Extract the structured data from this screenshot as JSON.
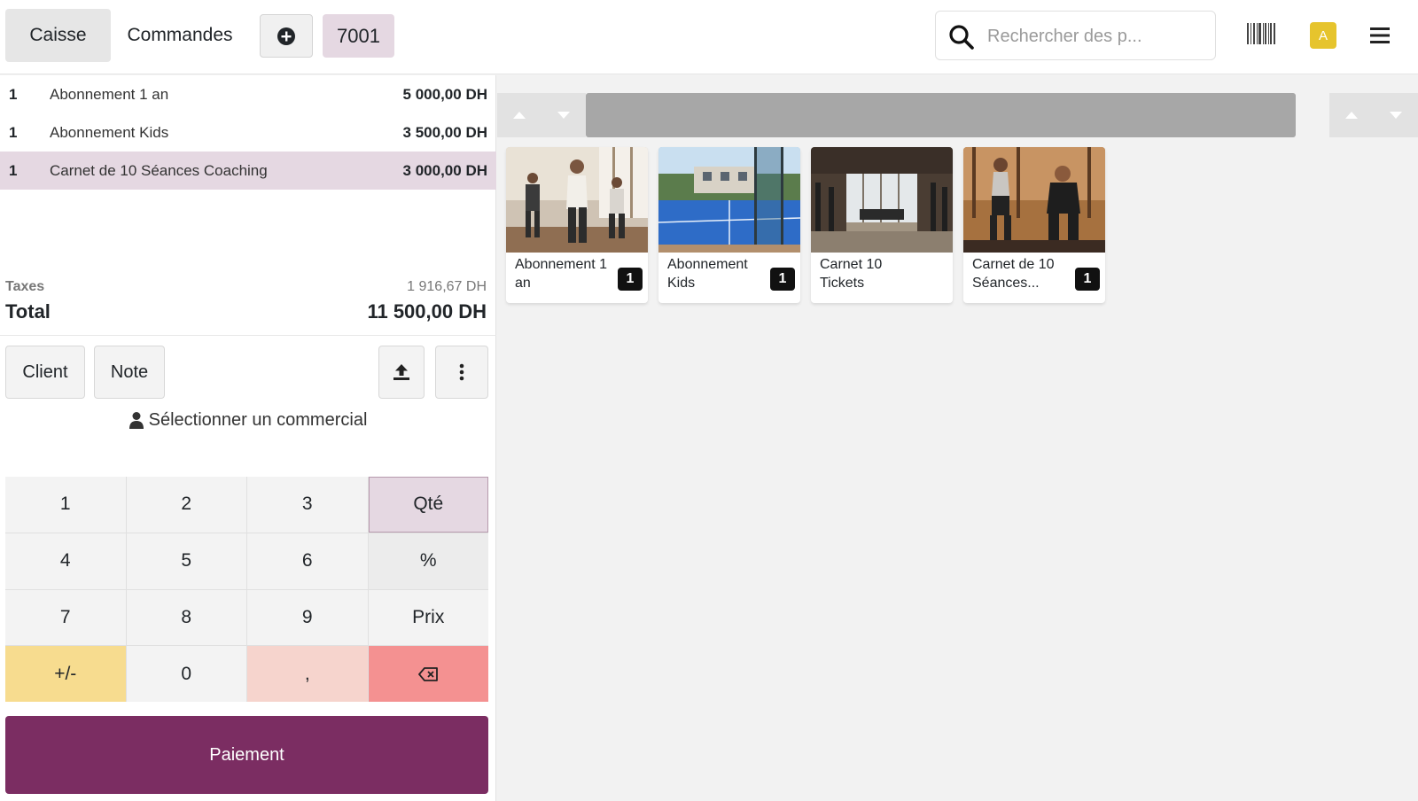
{
  "navbar": {
    "tab_caisse": "Caisse",
    "tab_commandes": "Commandes",
    "order_number": "7001",
    "search_placeholder": "Rechercher des p...",
    "avatar_initial": "A"
  },
  "order": {
    "lines": [
      {
        "qty": "1",
        "name": "Abonnement 1 an",
        "price": "5 000,00 DH",
        "selected": false
      },
      {
        "qty": "1",
        "name": "Abonnement Kids",
        "price": "3 500,00 DH",
        "selected": false
      },
      {
        "qty": "1",
        "name": "Carnet de 10 Séances Coaching",
        "price": "3 000,00 DH",
        "selected": true
      }
    ],
    "taxes_label": "Taxes",
    "taxes_value": "1 916,67 DH",
    "total_label": "Total",
    "total_value": "11 500,00 DH"
  },
  "controls": {
    "client_label": "Client",
    "note_label": "Note",
    "salesman_label": "Sélectionner un commercial"
  },
  "numpad": {
    "k1": "1",
    "k2": "2",
    "k3": "3",
    "qty": "Qté",
    "k4": "4",
    "k5": "5",
    "k6": "6",
    "pct": "%",
    "k7": "7",
    "k8": "8",
    "k9": "9",
    "price": "Prix",
    "sign": "+/-",
    "k0": "0",
    "comma": ","
  },
  "payment_label": "Paiement",
  "products": [
    {
      "name": "Abonnement 1 an",
      "count": "1"
    },
    {
      "name": "Abonnement Kids",
      "count": "1"
    },
    {
      "name": "Carnet 10 Tickets",
      "count": ""
    },
    {
      "name": "Carnet de 10 Séances...",
      "count": "1"
    }
  ],
  "colors": {
    "brand": "#7b2d62",
    "selected_line": "#e5d8e2",
    "sign_key": "#f7dc8f",
    "comma_key": "#f6d4cd",
    "backspace_key": "#f49191",
    "avatar": "#e6c42d"
  }
}
